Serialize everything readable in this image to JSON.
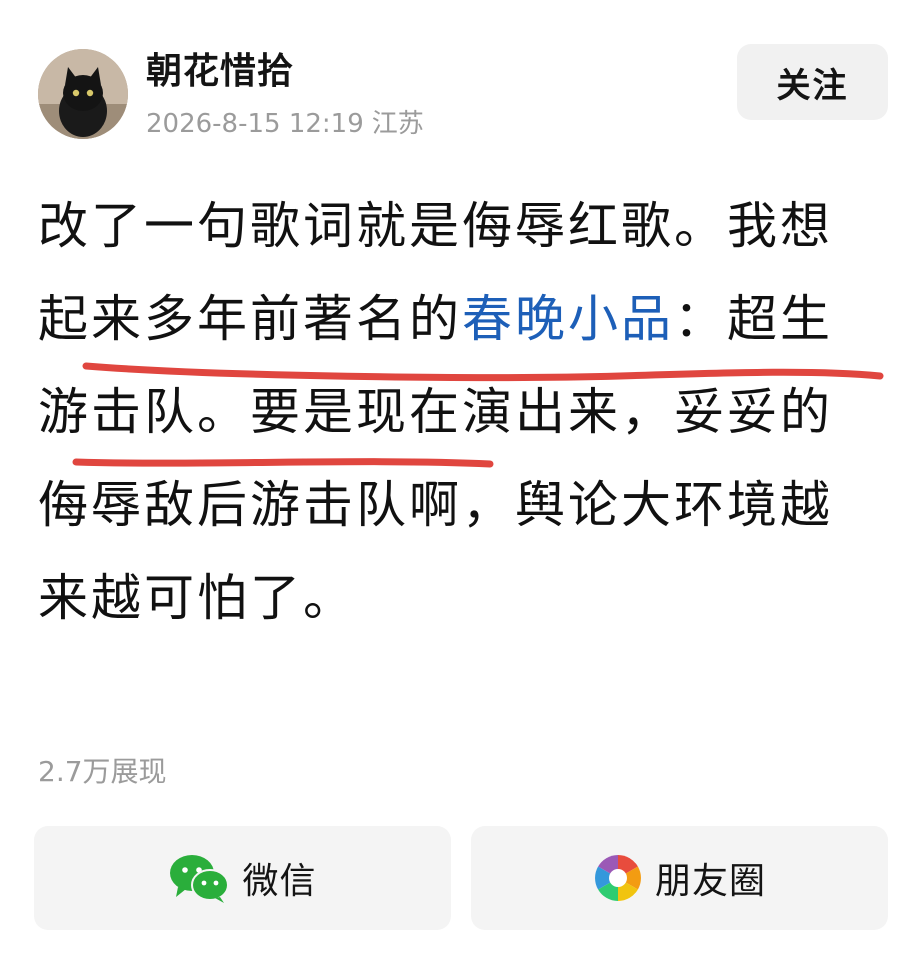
{
  "author": {
    "name": "朝花惜拾",
    "date": "2026-8-15 12:19",
    "location": "江苏"
  },
  "follow_label": "关注",
  "post": {
    "text_before": "改了一句歌词就是侮辱红歌。我想起来多年前著名的",
    "link_text": "春晚小品",
    "text_after": "：超生游击队。要是现在演出来，妥妥的侮辱敌后游击队啊，舆论大环境越来越可怕了。"
  },
  "stats": {
    "views": "2.7万展现"
  },
  "share": {
    "wechat_label": "微信",
    "moments_label": "朋友圈"
  },
  "colors": {
    "link": "#1d5fb8",
    "underline": "#e0463f",
    "wechat_green": "#2aae3b"
  }
}
